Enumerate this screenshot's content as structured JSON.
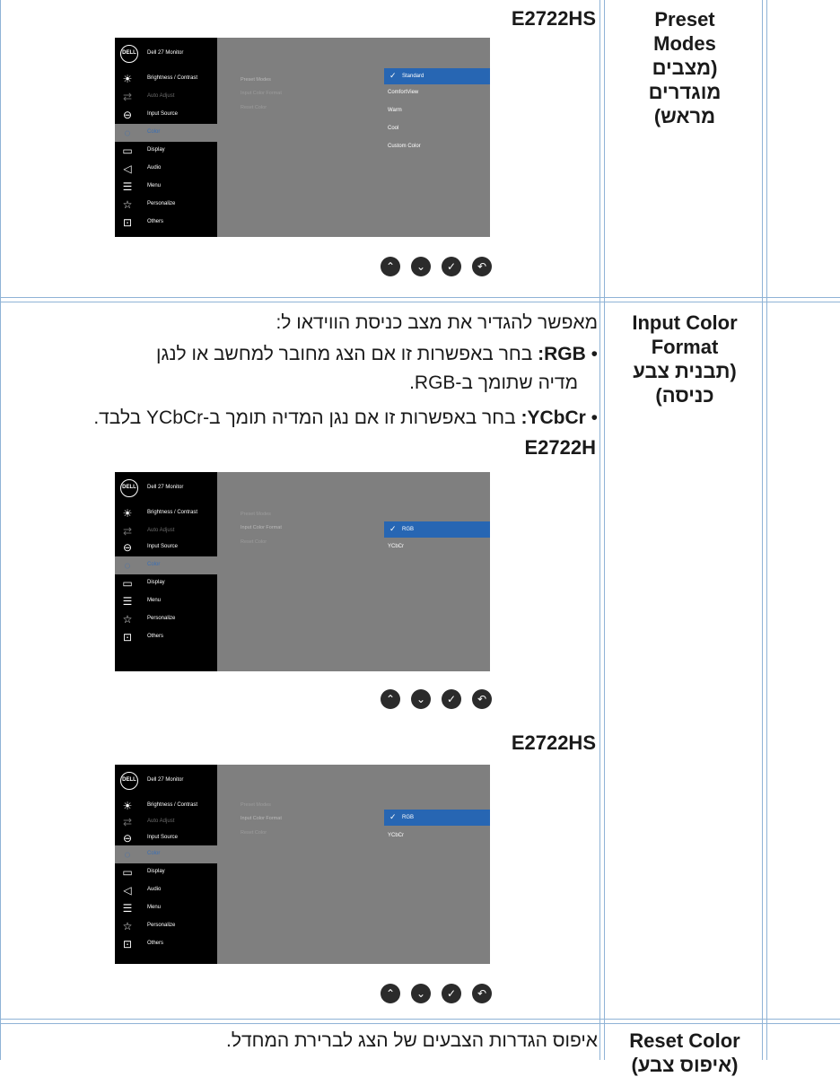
{
  "rows": [
    {
      "feature_label": "Preset Modes (מצבים מוגדרים מראש)"
    },
    {
      "feature_label": "Input Color Format (תבנית צבע כניסה)"
    },
    {
      "feature_label": "Reset Color (איפוס צבע)"
    }
  ],
  "preset": {
    "feature_en_1": "Preset",
    "feature_en_2": "Modes",
    "feature_he_1": "(מצבים",
    "feature_he_2": "מוגדרים",
    "feature_he_3": "מראש)",
    "model": "E2722HS"
  },
  "input_color": {
    "feature_en_1": "Input Color",
    "feature_en_2": "Format",
    "feature_he_1": "(תבנית צבע",
    "feature_he_2": "כניסה)",
    "intro": "מאפשר להגדיר את מצב כניסת הווידאו ל:",
    "rgb_term": "RGB:",
    "rgb_line1": " בחר באפשרות זו אם הצג מחובר למחשב או לנגן",
    "rgb_line2": "מדיה שתומך ב-RGB.",
    "ycbcr_term": "YCbCr:",
    "ycbcr_text": " בחר באפשרות זו אם נגן המדיה תומך ב-YCbCr בלבד.",
    "model_1": "E2722H",
    "model_2": "E2722HS"
  },
  "reset_color": {
    "feature_en": "Reset Color",
    "feature_he": "(איפוס צבע)",
    "desc": "איפוס הגדרות הצבעים של הצג לברירת המחדל."
  },
  "osd": {
    "logo": "DELL",
    "title": "Dell 27 Monitor",
    "menu_full": [
      "Brightness / Contrast",
      "Auto Adjust",
      "Input Source",
      "Color",
      "Display",
      "Audio",
      "Menu",
      "Personalize",
      "Others"
    ],
    "menu_noaudio": [
      "Brightness / Contrast",
      "Auto Adjust",
      "Input Source",
      "Color",
      "Display",
      "Menu",
      "Personalize",
      "Others"
    ],
    "submenu": [
      "Preset Modes",
      "Input Color Format",
      "Reset Color"
    ],
    "preset_options": [
      "Standard",
      "ComfortView",
      "Warm",
      "Cool",
      "Custom Color"
    ],
    "format_options": [
      "RGB",
      "YCbCr"
    ]
  },
  "nav_icons": [
    "up-icon",
    "down-icon",
    "check-icon",
    "back-icon"
  ]
}
